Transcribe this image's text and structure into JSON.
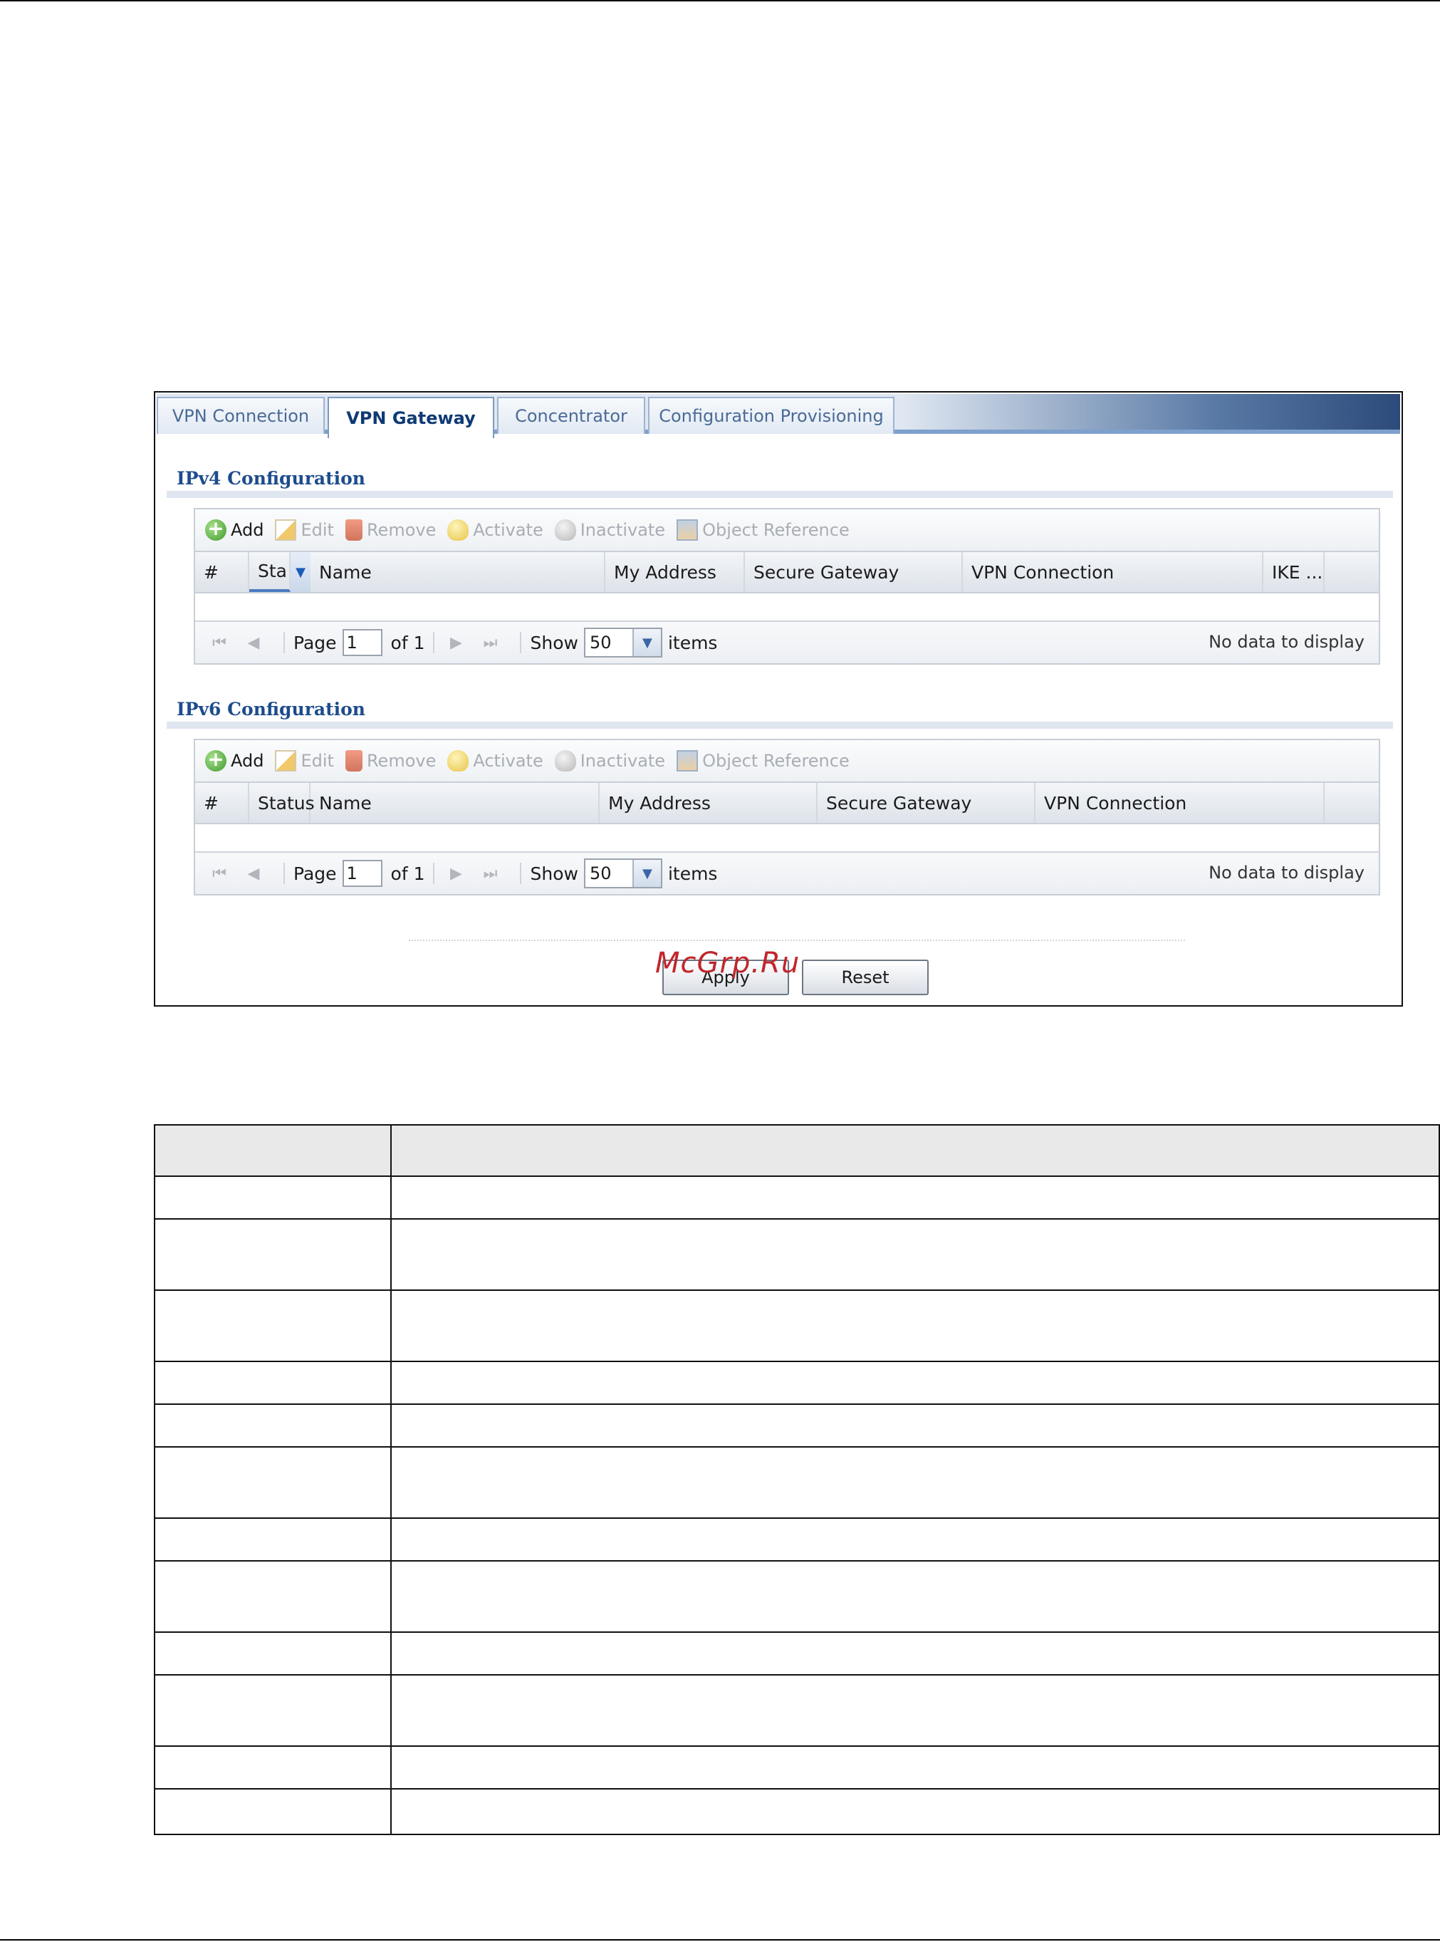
{
  "tabs": [
    "VPN Connection",
    "VPN Gateway",
    "Concentrator",
    "Configuration Provisioning"
  ],
  "active_tab": "VPN Gateway",
  "ipv4": {
    "title": "IPv4 Configuration",
    "toolbar": [
      "Add",
      "Edit",
      "Remove",
      "Activate",
      "Inactivate",
      "Object Reference"
    ],
    "columns": [
      "#",
      "Sta",
      "Name",
      "My Address",
      "Secure Gateway",
      "VPN Connection",
      "IKE ..."
    ],
    "pager": {
      "page_label": "Page",
      "page_value": "1",
      "of_label": "of 1",
      "show_label": "Show",
      "show_value": "50",
      "items_label": "items",
      "no_data": "No data to display"
    }
  },
  "ipv6": {
    "title": "IPv6 Configuration",
    "toolbar": [
      "Add",
      "Edit",
      "Remove",
      "Activate",
      "Inactivate",
      "Object Reference"
    ],
    "columns": [
      "#",
      "Status",
      "Name",
      "My Address",
      "Secure Gateway",
      "VPN Connection"
    ],
    "pager": {
      "page_label": "Page",
      "page_value": "1",
      "of_label": "of 1",
      "show_label": "Show",
      "show_value": "50",
      "items_label": "items",
      "no_data": "No data to display"
    }
  },
  "buttons": {
    "apply": "Apply",
    "reset": "Reset"
  },
  "watermark": "McGrp.Ru"
}
